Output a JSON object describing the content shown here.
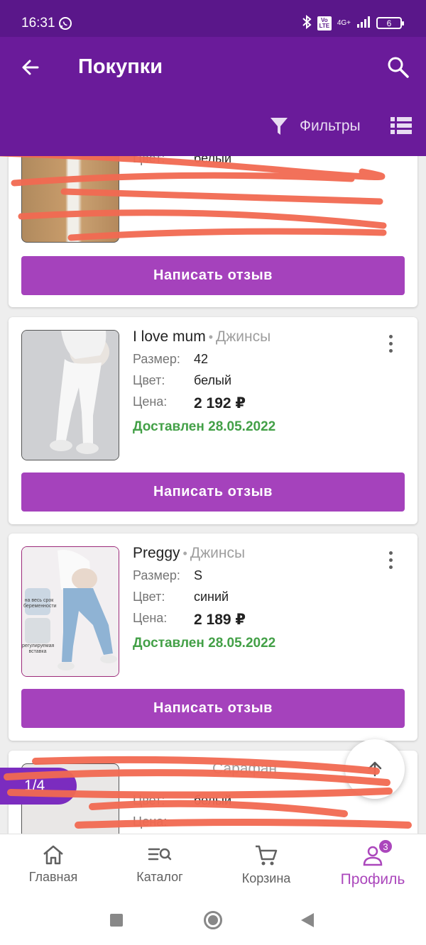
{
  "status_bar": {
    "time": "16:31",
    "network": "4G+",
    "volte": "Vo LTE",
    "battery": "6"
  },
  "app_bar": {
    "title": "Покупки",
    "filter_label": "Фильтры"
  },
  "cards": [
    {
      "color_label": "Цвет:",
      "color_value": "белый",
      "review_label": "Написать отзыв"
    },
    {
      "brand": "I love mum",
      "category": "Джинсы",
      "size_label": "Размер:",
      "size_value": "42",
      "color_label": "Цвет:",
      "color_value": "белый",
      "price_label": "Цена:",
      "price_value": "2 192 ₽",
      "status": "Доставлен 28.05.2022",
      "review_label": "Написать отзыв"
    },
    {
      "brand": "Preggy",
      "category": "Джинсы",
      "size_label": "Размер:",
      "size_value": "S",
      "color_label": "Цвет:",
      "color_value": "синий",
      "price_label": "Цена:",
      "price_value": "2 189 ₽",
      "status": "Доставлен 28.05.2022",
      "review_label": "Написать отзыв",
      "image_captions": [
        "на весь срок беременности",
        "регулируемая вставка"
      ]
    },
    {
      "category": "Сарафан",
      "color_label": "Цвет:",
      "color_value": "белый",
      "price_label": "Цена:"
    }
  ],
  "page_indicator": "1/4",
  "bottom_nav": [
    {
      "label": "Главная",
      "icon": "home-icon"
    },
    {
      "label": "Каталог",
      "icon": "catalog-search-icon"
    },
    {
      "label": "Корзина",
      "icon": "cart-icon"
    },
    {
      "label": "Профиль",
      "icon": "profile-icon",
      "badge": "3",
      "active": true
    }
  ],
  "colors": {
    "status_bar": "#5a178a",
    "app_bar": "#6a1b9a",
    "accent": "#a542bc",
    "delivered": "#43a047",
    "scribble": "#f26a52"
  }
}
